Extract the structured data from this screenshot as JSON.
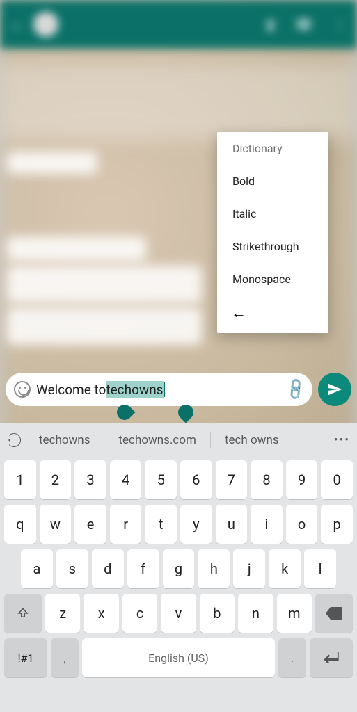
{
  "header": {
    "contact_name": "",
    "last_seen": ""
  },
  "context_menu": {
    "items": [
      "Dictionary",
      "Bold",
      "Italic",
      "Strikethrough",
      "Monospace"
    ]
  },
  "input": {
    "prefix": "Welcome to ",
    "selected": "techowns",
    "emoji_icon": "emoji",
    "attach_icon": "attach",
    "send_icon": "send"
  },
  "suggestions": {
    "items": [
      "techowns",
      "techowns.com",
      "tech owns"
    ]
  },
  "keyboard": {
    "row1": [
      "1",
      "2",
      "3",
      "4",
      "5",
      "6",
      "7",
      "8",
      "9",
      "0"
    ],
    "row2": [
      "q",
      "w",
      "e",
      "r",
      "t",
      "y",
      "u",
      "i",
      "o",
      "p"
    ],
    "row3": [
      "a",
      "s",
      "d",
      "f",
      "g",
      "h",
      "j",
      "k",
      "l"
    ],
    "row4_mid": [
      "z",
      "x",
      "c",
      "v",
      "b",
      "n",
      "m"
    ],
    "shift": "⇧",
    "sym": "!#1",
    "comma": ",",
    "dot": ".",
    "space_label": "English (US)"
  }
}
